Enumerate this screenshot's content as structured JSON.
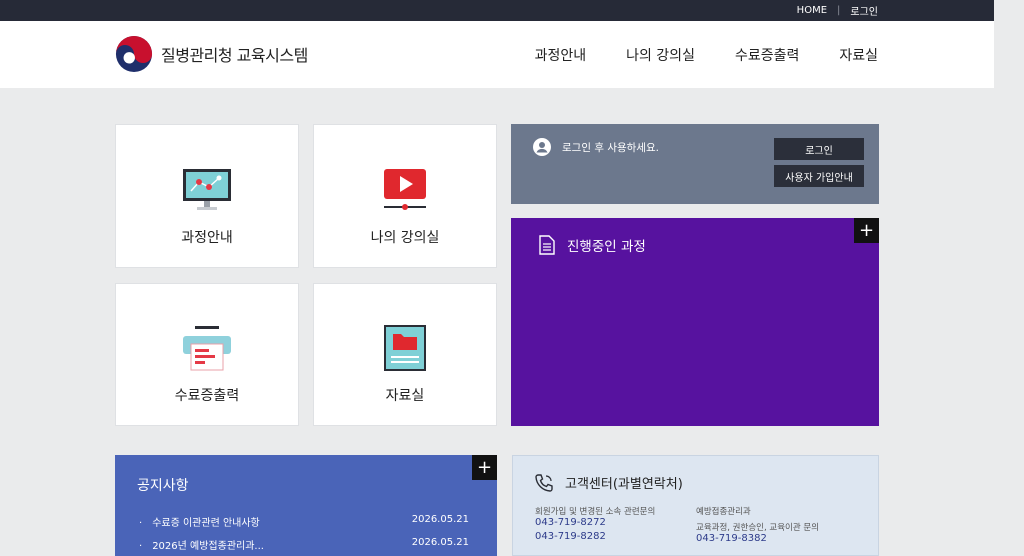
{
  "topbar": {
    "home": "HOME",
    "login": "로그인"
  },
  "header": {
    "site_name": "질병관리청 교육시스템",
    "nav": [
      "과정안내",
      "나의 강의실",
      "수료증출력",
      "자료실"
    ]
  },
  "tiles": [
    {
      "label": "과정안내",
      "icon": "monitor-chart-icon"
    },
    {
      "label": "나의 강의실",
      "icon": "video-play-icon"
    },
    {
      "label": "수료증출력",
      "icon": "printer-icon"
    },
    {
      "label": "자료실",
      "icon": "folder-board-icon"
    }
  ],
  "login_box": {
    "message": "로그인 후 사용하세요.",
    "login_button": "로그인",
    "signup_button": "사용자 가입안내"
  },
  "progress": {
    "title": "진행중인 과정",
    "plus": "+"
  },
  "notice": {
    "title": "공지사항",
    "plus": "+",
    "items": [
      {
        "title": "수료증 이관관련 안내사항",
        "date": "2026.05.21"
      },
      {
        "title": "2026년 예방접종관리과...",
        "date": "2026.05.21"
      }
    ]
  },
  "customer_center": {
    "title": "고객센터(과별연락처)",
    "left_desc": "회원가입 및 변경된 소속 관련문의",
    "left_phones": [
      "043-719-8272",
      "043-719-8282"
    ],
    "right_dept": "예방접종관리과",
    "right_desc": "교육과정, 권한승인, 교육이관 문의",
    "right_phone": "043-719-8382"
  },
  "colors": {
    "topbar": "#262a37",
    "login_box": "#6c788d",
    "progress": "#57129f",
    "notice": "#4a64b8",
    "customer_center": "#dde6f1"
  }
}
